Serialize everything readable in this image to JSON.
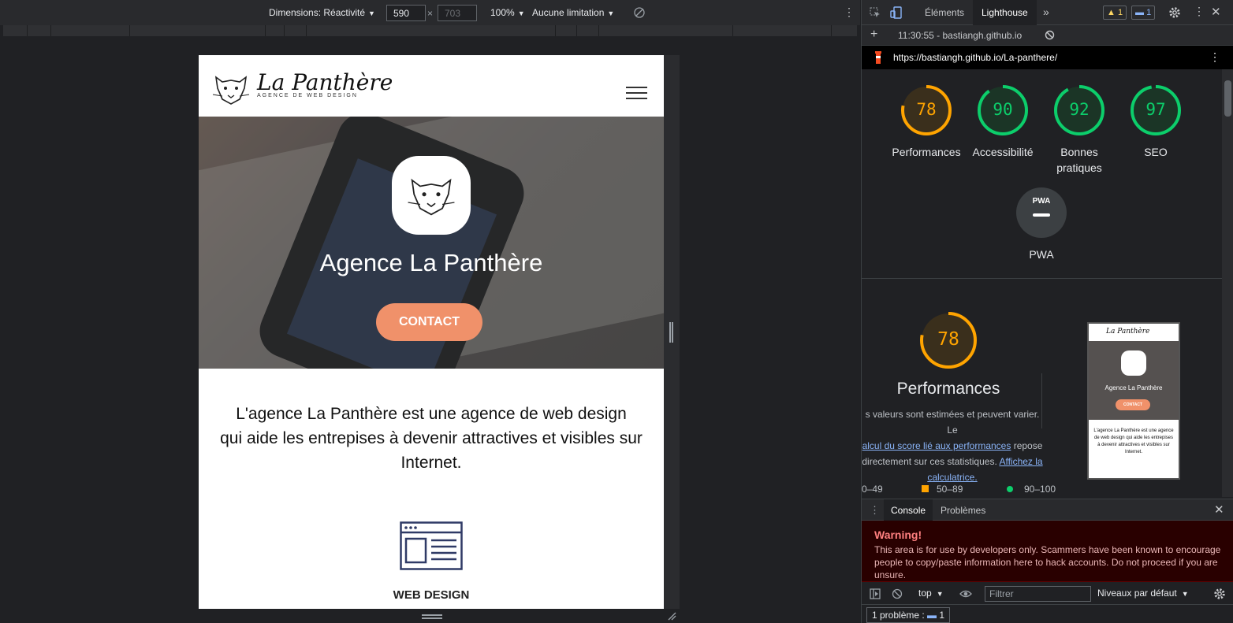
{
  "device_toolbar": {
    "dimensions_label": "Dimensions: Réactivité",
    "width_value": "590",
    "times": "×",
    "height_placeholder": "703",
    "zoom": "100%",
    "throttle": "Aucune limitation"
  },
  "page": {
    "brand_title": "La Panthère",
    "brand_subtitle": "AGENCE DE WEB DESIGN",
    "hero_title": "Agence La Panthère",
    "contact_button": "CONTACT",
    "intro_line1": "L'agence La Panthère est une agence de web design",
    "intro_line2": "qui aide les entrepises à devenir attractives et visibles sur",
    "intro_line3": "Internet.",
    "service_label": "WEB DESIGN"
  },
  "devtools": {
    "tabs": {
      "elements": "Éléments",
      "lighthouse": "Lighthouse",
      "more": "»"
    },
    "warnings_count": "1",
    "messages_count": "1",
    "lighthouse_bar": {
      "add": "+",
      "report_label": "11:30:55 - bastiangh.github.io"
    },
    "url": "https://bastiangh.github.io/La-panthere/",
    "scores": [
      {
        "label": "Performances",
        "value": "78",
        "fraction": 0.78,
        "color": "#ffa400"
      },
      {
        "label": "Accessibilité",
        "value": "90",
        "fraction": 0.9,
        "color": "#0cce6b"
      },
      {
        "label": "Bonnes pratiques",
        "value": "92",
        "fraction": 0.92,
        "color": "#0cce6b"
      },
      {
        "label": "SEO",
        "value": "97",
        "fraction": 0.97,
        "color": "#0cce6b"
      }
    ],
    "pwa": {
      "badge": "PWA",
      "label": "PWA"
    },
    "performance": {
      "score": "78",
      "fraction": 0.78,
      "title": "Performances",
      "desc_prefix": "s valeurs sont estimées et peuvent varier. Le",
      "desc_link1": "alcul du score lié aux performances",
      "desc_mid": "repose",
      "desc_line3": "directement sur ces statistiques.",
      "desc_link2": "Affichez la",
      "desc_link3": "calculatrice."
    },
    "legend": [
      {
        "range": "0–49",
        "color": "#ff4e42"
      },
      {
        "range": "50–89",
        "color": "#ffa400"
      },
      {
        "range": "90–100",
        "color": "#0cce6b"
      }
    ],
    "thumbnail": {
      "brand": "La Panthère",
      "hero": "Agence La Panthère",
      "button": "CONTACT",
      "text": "L'agence La Panthère est une agence de web design qui aide les entrepises à devenir attractives et visibles sur Internet."
    },
    "console": {
      "tab_console": "Console",
      "tab_problems": "Problèmes",
      "warning_title": "Warning!",
      "warning_text": "This area is for use by developers only. Scammers have been known to encourage people to copy/paste information here to hack accounts. Do not proceed if you are unsure.",
      "context": "top",
      "filter_placeholder": "Filtrer",
      "levels": "Niveaux par défaut",
      "problems_label": "1 problème :",
      "problems_count": "1"
    }
  }
}
